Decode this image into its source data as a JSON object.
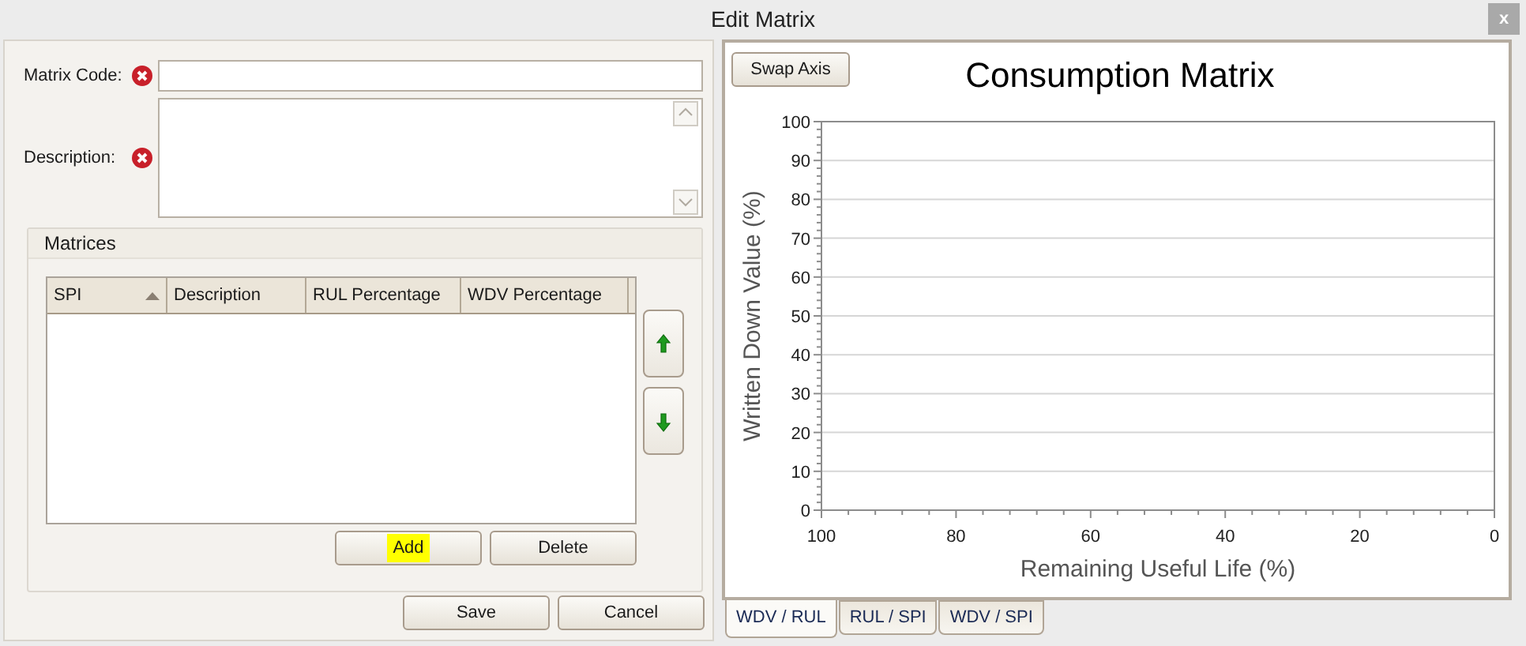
{
  "window": {
    "title": "Edit Matrix",
    "close": "x"
  },
  "fields": [
    {
      "label": "Matrix Code:",
      "error": true,
      "kind": "line"
    },
    {
      "label": "Description:",
      "error": true,
      "kind": "multiline"
    }
  ],
  "matrices": {
    "title": "Matrices",
    "columns": [
      {
        "label": "SPI",
        "sorted": true
      },
      {
        "label": "Description",
        "sorted": false
      },
      {
        "label": "RUL Percentage",
        "sorted": false
      },
      {
        "label": "WDV Percentage",
        "sorted": false
      }
    ],
    "buttons": [
      {
        "label": "Add",
        "highlighted": true
      },
      {
        "label": "Delete",
        "highlighted": false
      }
    ]
  },
  "buttons": [
    {
      "label": "Save"
    },
    {
      "label": "Cancel"
    }
  ],
  "swap_button": "Swap Axis",
  "chart_data": {
    "type": "scatter",
    "title": "Consumption Matrix",
    "xlabel": "Remaining Useful Life (%)",
    "ylabel": "Written Down Value (%)",
    "xlim": [
      100,
      0
    ],
    "ylim": [
      0,
      100
    ],
    "xticks": [
      100,
      80,
      60,
      40,
      20,
      0
    ],
    "yticks": [
      0,
      10,
      20,
      30,
      40,
      50,
      60,
      70,
      80,
      90,
      100
    ],
    "grid": true
  },
  "tabs": [
    {
      "label": "WDV / RUL",
      "selected": true
    },
    {
      "label": "RUL / SPI",
      "selected": false
    },
    {
      "label": "WDV / SPI",
      "selected": false
    }
  ]
}
